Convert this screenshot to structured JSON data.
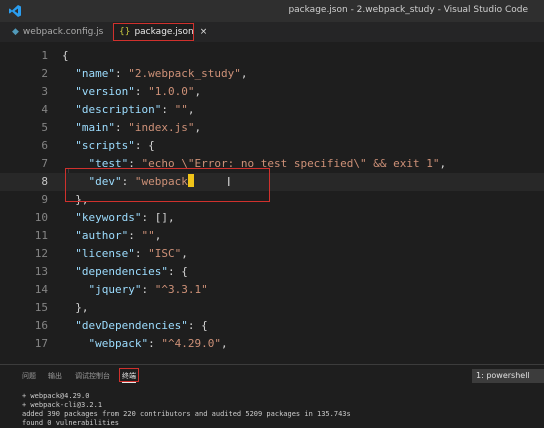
{
  "window": {
    "title": "package.json - 2.webpack_study - Visual Studio Code"
  },
  "tabs": [
    {
      "label": "webpack.config.js",
      "icon": "js-file-icon",
      "active": false
    },
    {
      "label": "package.json",
      "icon": "json-file-icon",
      "active": true,
      "close": "×"
    }
  ],
  "editor": {
    "active_line": 8,
    "lines": [
      {
        "n": "1",
        "tokens": [
          {
            "t": "p",
            "v": "{"
          }
        ]
      },
      {
        "n": "2",
        "tokens": [
          {
            "t": "p",
            "v": "  "
          },
          {
            "t": "k",
            "v": "\"name\""
          },
          {
            "t": "p",
            "v": ": "
          },
          {
            "t": "s",
            "v": "\"2.webpack_study\""
          },
          {
            "t": "p",
            "v": ","
          }
        ]
      },
      {
        "n": "3",
        "tokens": [
          {
            "t": "p",
            "v": "  "
          },
          {
            "t": "k",
            "v": "\"version\""
          },
          {
            "t": "p",
            "v": ": "
          },
          {
            "t": "s",
            "v": "\"1.0.0\""
          },
          {
            "t": "p",
            "v": ","
          }
        ]
      },
      {
        "n": "4",
        "tokens": [
          {
            "t": "p",
            "v": "  "
          },
          {
            "t": "k",
            "v": "\"description\""
          },
          {
            "t": "p",
            "v": ": "
          },
          {
            "t": "s",
            "v": "\"\""
          },
          {
            "t": "p",
            "v": ","
          }
        ]
      },
      {
        "n": "5",
        "tokens": [
          {
            "t": "p",
            "v": "  "
          },
          {
            "t": "k",
            "v": "\"main\""
          },
          {
            "t": "p",
            "v": ": "
          },
          {
            "t": "s",
            "v": "\"index.js\""
          },
          {
            "t": "p",
            "v": ","
          }
        ]
      },
      {
        "n": "6",
        "tokens": [
          {
            "t": "p",
            "v": "  "
          },
          {
            "t": "k",
            "v": "\"scripts\""
          },
          {
            "t": "p",
            "v": ": {"
          }
        ]
      },
      {
        "n": "7",
        "tokens": [
          {
            "t": "p",
            "v": "    "
          },
          {
            "t": "k",
            "v": "\"test\""
          },
          {
            "t": "p",
            "v": ": "
          },
          {
            "t": "s",
            "v": "\"echo \\\"Error: no test specified\\\" && exit 1\""
          },
          {
            "t": "p",
            "v": ","
          }
        ]
      },
      {
        "n": "8",
        "tokens": [
          {
            "t": "p",
            "v": "    "
          },
          {
            "t": "k",
            "v": "\"dev\""
          },
          {
            "t": "p",
            "v": ": "
          },
          {
            "t": "s",
            "v": "\"webpack"
          }
        ],
        "caret": true
      },
      {
        "n": "9",
        "tokens": [
          {
            "t": "p",
            "v": "  },"
          }
        ]
      },
      {
        "n": "10",
        "tokens": [
          {
            "t": "p",
            "v": "  "
          },
          {
            "t": "k",
            "v": "\"keywords\""
          },
          {
            "t": "p",
            "v": ": [],"
          }
        ]
      },
      {
        "n": "11",
        "tokens": [
          {
            "t": "p",
            "v": "  "
          },
          {
            "t": "k",
            "v": "\"author\""
          },
          {
            "t": "p",
            "v": ": "
          },
          {
            "t": "s",
            "v": "\"\""
          },
          {
            "t": "p",
            "v": ","
          }
        ]
      },
      {
        "n": "12",
        "tokens": [
          {
            "t": "p",
            "v": "  "
          },
          {
            "t": "k",
            "v": "\"license\""
          },
          {
            "t": "p",
            "v": ": "
          },
          {
            "t": "s",
            "v": "\"ISC\""
          },
          {
            "t": "p",
            "v": ","
          }
        ]
      },
      {
        "n": "13",
        "tokens": [
          {
            "t": "p",
            "v": "  "
          },
          {
            "t": "k",
            "v": "\"dependencies\""
          },
          {
            "t": "p",
            "v": ": {"
          }
        ]
      },
      {
        "n": "14",
        "tokens": [
          {
            "t": "p",
            "v": "    "
          },
          {
            "t": "k",
            "v": "\"jquery\""
          },
          {
            "t": "p",
            "v": ": "
          },
          {
            "t": "s",
            "v": "\"^3.3.1\""
          }
        ]
      },
      {
        "n": "15",
        "tokens": [
          {
            "t": "p",
            "v": "  },"
          }
        ]
      },
      {
        "n": "16",
        "tokens": [
          {
            "t": "p",
            "v": "  "
          },
          {
            "t": "k",
            "v": "\"devDependencies\""
          },
          {
            "t": "p",
            "v": ": {"
          }
        ]
      },
      {
        "n": "17",
        "tokens": [
          {
            "t": "p",
            "v": "    "
          },
          {
            "t": "k",
            "v": "\"webpack\""
          },
          {
            "t": "p",
            "v": ": "
          },
          {
            "t": "s",
            "v": "\"^4.29.0\""
          },
          {
            "t": "p",
            "v": ","
          }
        ]
      }
    ]
  },
  "panel": {
    "tabs": [
      {
        "label": "问题",
        "active": false
      },
      {
        "label": "输出",
        "active": false
      },
      {
        "label": "调试控制台",
        "active": false
      },
      {
        "label": "终端",
        "active": true
      }
    ],
    "terminal_select": "1: powershell",
    "terminal_lines": [
      "+ webpack@4.29.0",
      "+ webpack-cli@3.2.1",
      "added 390 packages from 220 contributors and audited 5209 packages in 135.743s",
      "found 0 vulnerabilities"
    ]
  },
  "colors": {
    "highlight_box": "#d0312d",
    "caret": "#f0c419",
    "key": "#9cdcfe",
    "string": "#ce9178"
  }
}
